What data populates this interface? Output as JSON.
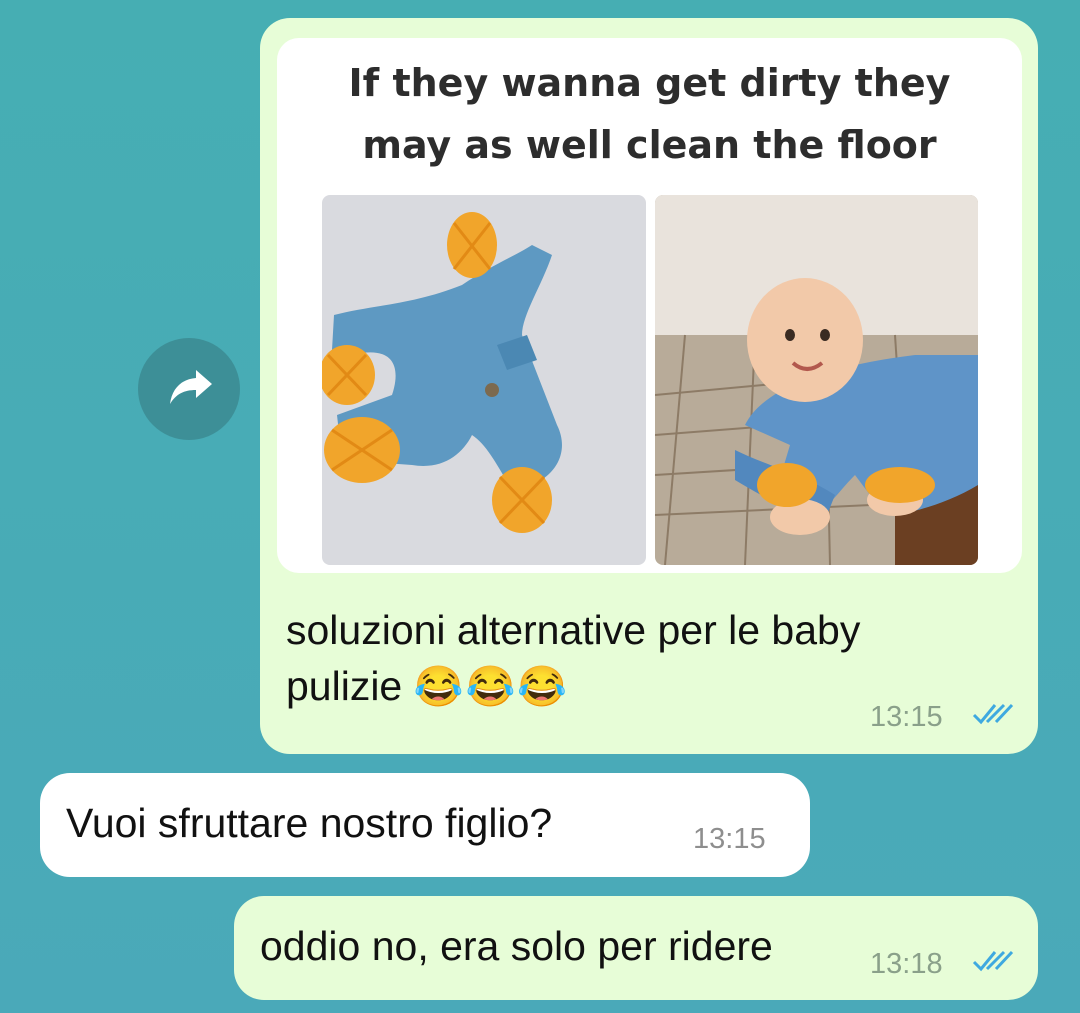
{
  "messages": [
    {
      "direction": "outgoing",
      "meme_caption_line1": "If they wanna get dirty they",
      "meme_caption_line2": "may as well clean the floor",
      "text_line1": "soluzioni alternative per le baby",
      "text_line2": "pulizie",
      "emoji": "😂😂😂",
      "time": "13:15",
      "status": "read"
    },
    {
      "direction": "incoming",
      "text": "Vuoi sfruttare nostro figlio?",
      "time": "13:15"
    },
    {
      "direction": "outgoing",
      "text": "oddio no, era solo per ridere",
      "time": "13:18",
      "status": "read"
    }
  ],
  "forward_button": {
    "icon": "share-arrow-icon"
  },
  "colors": {
    "background": "#46aeb3",
    "outgoing_bubble": "#e7fdd7",
    "incoming_bubble": "#ffffff",
    "read_ticks": "#3fa9e0"
  }
}
